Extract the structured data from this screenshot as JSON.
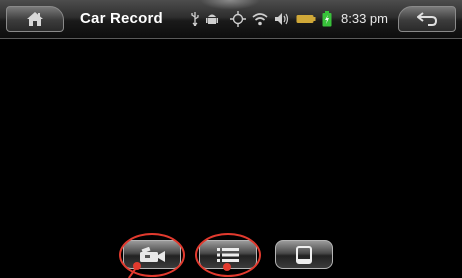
{
  "titlebar": {
    "title": "Car Record",
    "clock": "8:33 pm",
    "home_icon": "home-icon",
    "back_icon": "back-arrow-icon",
    "status_icons": [
      "usb-icon",
      "android-debug-icon",
      "gps-icon",
      "wifi-icon",
      "volume-icon",
      "battery-icon",
      "charging-battery-icon"
    ]
  },
  "toolbar": {
    "buttons": [
      {
        "icon": "video-camera-icon",
        "annotated": true
      },
      {
        "icon": "list-icon",
        "annotated": true
      },
      {
        "icon": "tablet-icon",
        "annotated": false
      }
    ]
  },
  "colors": {
    "annotation": "#e23a2e",
    "background": "#000000",
    "battery_green": "#38c23a"
  }
}
